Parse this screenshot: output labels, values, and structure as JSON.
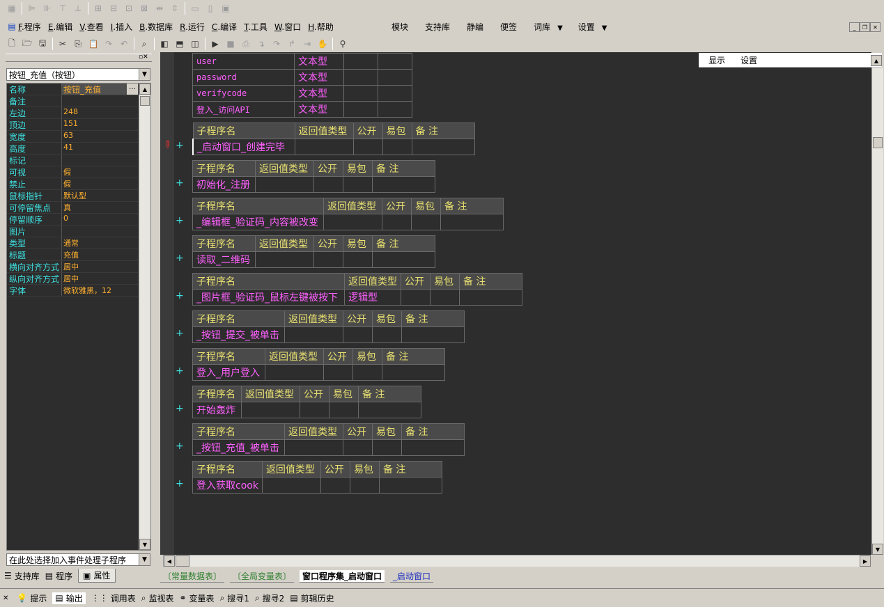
{
  "menu": {
    "items": [
      {
        "key": "F",
        "label": ".程序"
      },
      {
        "key": "E",
        "label": ".编辑"
      },
      {
        "key": "V",
        "label": ".查看"
      },
      {
        "key": "I",
        "label": ".插入"
      },
      {
        "key": "B",
        "label": ".数据库"
      },
      {
        "key": "R",
        "label": ".运行"
      },
      {
        "key": "C",
        "label": ".编译"
      },
      {
        "key": "T",
        "label": ".工具"
      },
      {
        "key": "W",
        "label": ".窗口"
      },
      {
        "key": "H",
        "label": ".帮助"
      }
    ],
    "right": [
      "模块",
      "支持库",
      "静编",
      "便签",
      "词库",
      "设置"
    ]
  },
  "left": {
    "object_combo": "按钮_充值（按钮）",
    "props": [
      [
        "名称",
        "按钮_充值"
      ],
      [
        "备注",
        ""
      ],
      [
        "左边",
        "248"
      ],
      [
        "顶边",
        "151"
      ],
      [
        "宽度",
        "63"
      ],
      [
        "高度",
        "41"
      ],
      [
        "标记",
        ""
      ],
      [
        "可视",
        "假"
      ],
      [
        "禁止",
        "假"
      ],
      [
        "鼠标指针",
        "默认型"
      ],
      [
        "可停留焦点",
        "真"
      ],
      [
        "  停留顺序",
        "0"
      ],
      [
        "图片",
        ""
      ],
      [
        "类型",
        "通常"
      ],
      [
        "标题",
        "充值"
      ],
      [
        "横向对齐方式",
        "居中"
      ],
      [
        "纵向对齐方式",
        "居中"
      ],
      [
        "字体",
        "微软雅黑，12"
      ]
    ],
    "event_combo": "在此处选择加入事件处理子程序",
    "tabs": [
      "支持库",
      "程序",
      "属性"
    ]
  },
  "right_panel": {
    "show": "显示",
    "settings": "设置"
  },
  "editor": {
    "vars": [
      [
        "user",
        "文本型"
      ],
      [
        "password",
        "文本型"
      ],
      [
        "verifycode",
        "文本型"
      ],
      [
        "登入_访问API",
        "文本型"
      ]
    ],
    "headers": {
      "name": "子程序名",
      "ret": "返回值类型",
      "pub": "公开",
      "easy": "易包",
      "note": "备 注"
    },
    "subs": [
      {
        "name": "_启动窗口_创建完毕",
        "ret": ""
      },
      {
        "name": "初始化_注册",
        "ret": ""
      },
      {
        "name": "_编辑框_验证码_内容被改变",
        "ret": ""
      },
      {
        "name": "读取_二维码",
        "ret": ""
      },
      {
        "name": "_图片框_验证码_鼠标左键被按下",
        "ret": "逻辑型"
      },
      {
        "name": "_按钮_提交_被单击",
        "ret": ""
      },
      {
        "name": "登入_用户登入",
        "ret": ""
      },
      {
        "name": "开始轰炸",
        "ret": ""
      },
      {
        "name": "_按钮_充值_被单击",
        "ret": ""
      },
      {
        "name": "登入获取cook",
        "ret": ""
      }
    ],
    "plus": "+"
  },
  "doc_tabs": [
    "〔常量数据表〕",
    "〔全局变量表〕",
    "窗口程序集_启动窗口",
    "_启动窗口"
  ],
  "bottom_tabs": [
    "提示",
    "输出",
    "调用表",
    "监视表",
    "变量表",
    "搜寻1",
    "搜寻2",
    "剪辑历史"
  ],
  "colors": {
    "editor_bg": "#2d2d2d",
    "header_fg": "#e8e070",
    "name_fg": "#ff60ff",
    "prop_name": "#3ee0e0",
    "prop_value": "#ffb030"
  }
}
